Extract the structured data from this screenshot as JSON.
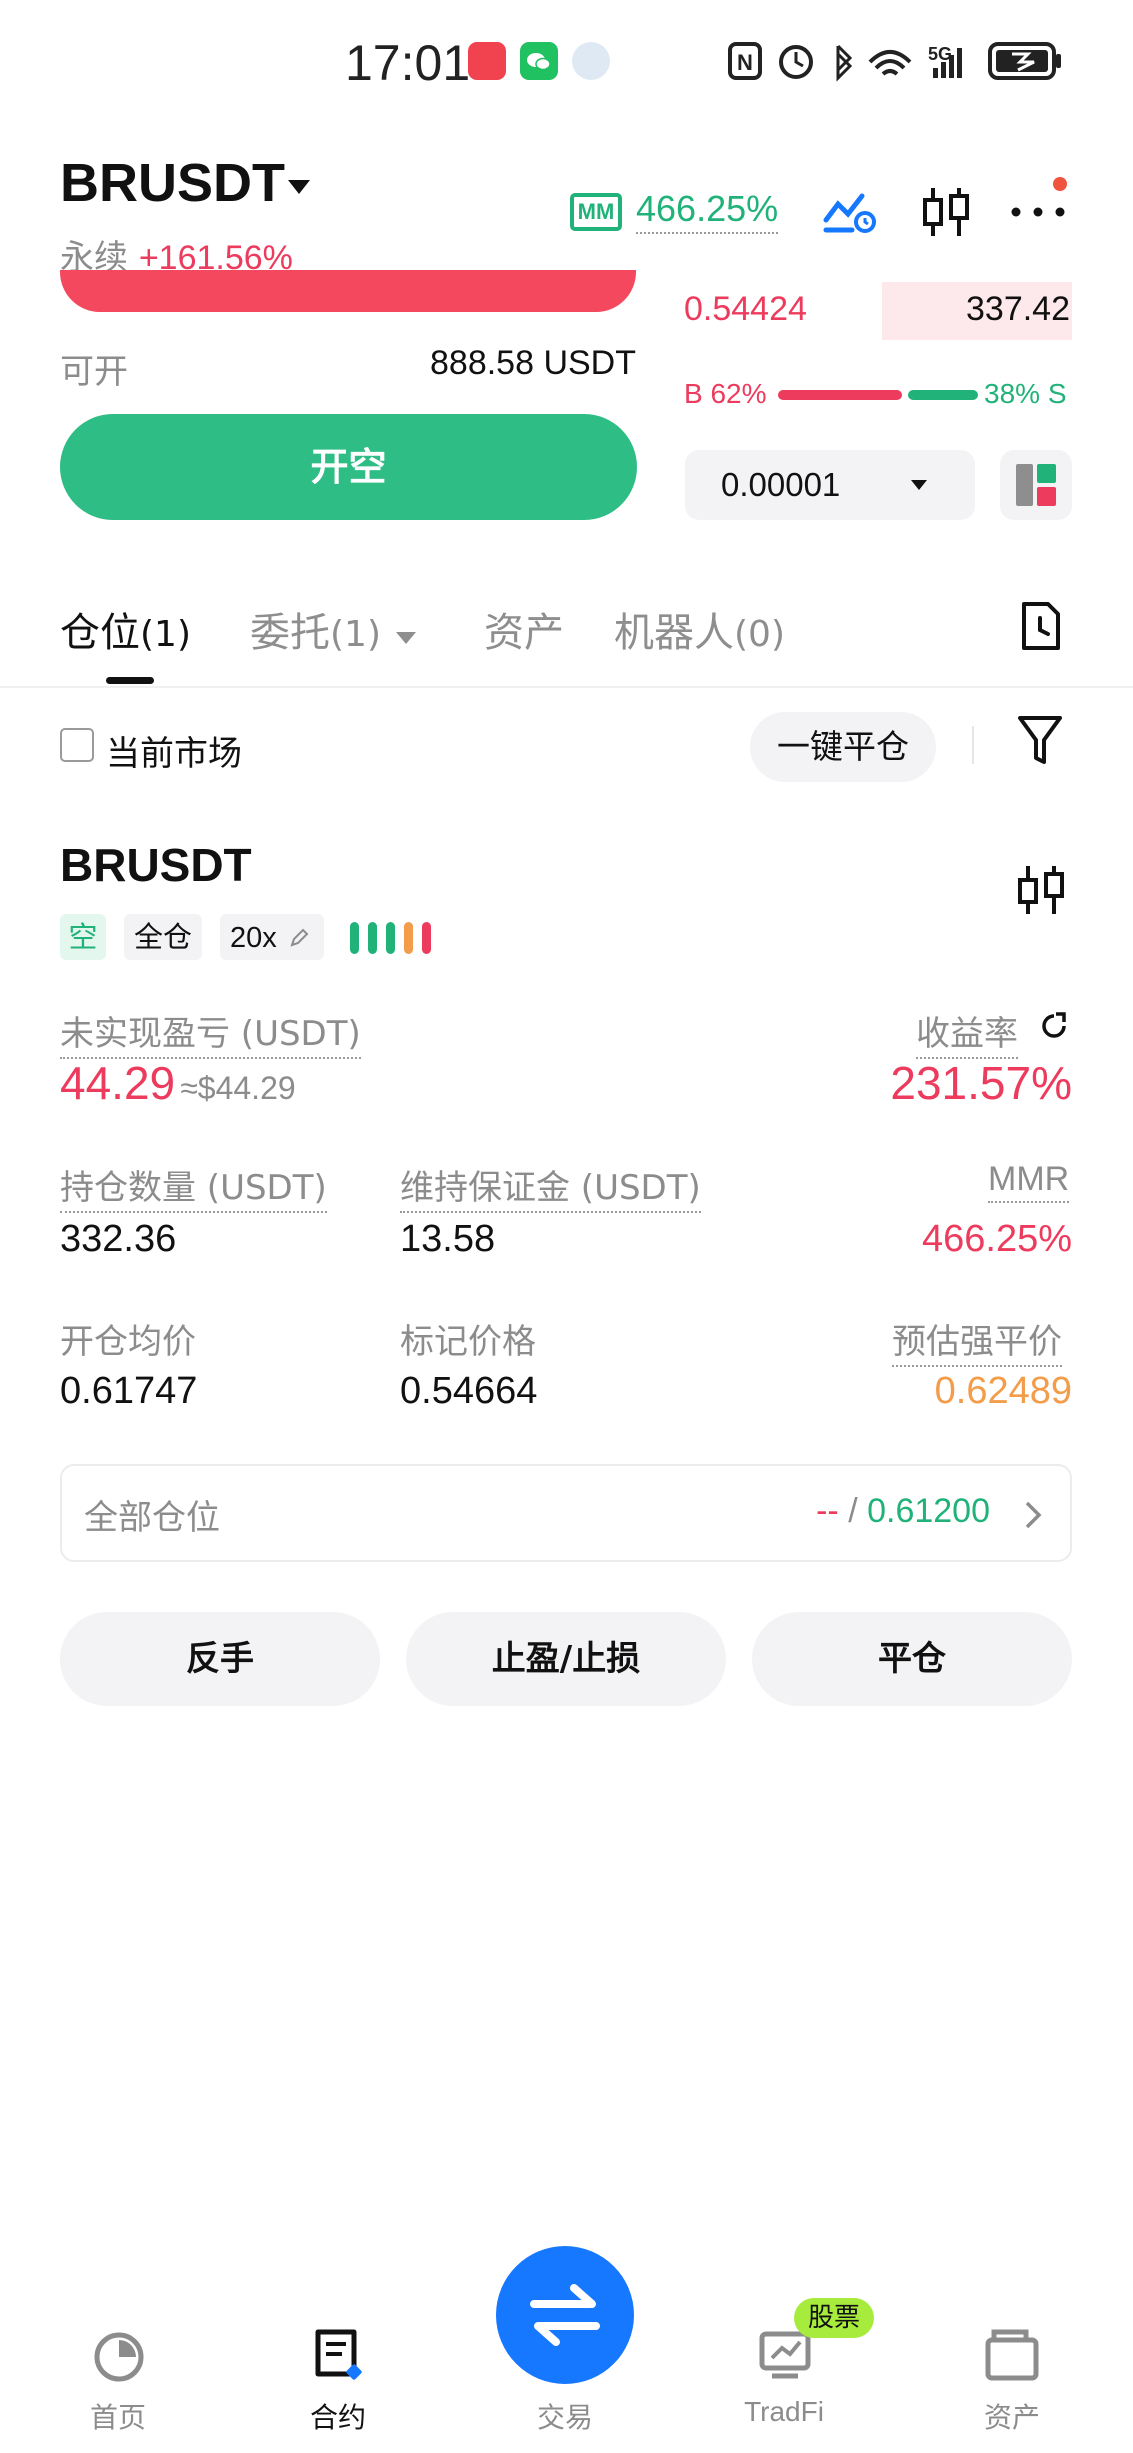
{
  "status_bar": {
    "time": "17:01",
    "network": "5G"
  },
  "header": {
    "symbol": "BRUSDT",
    "contract_type": "永续",
    "change_pct": "+161.56%",
    "mmr_badge": "MM",
    "mmr_value": "466.25%"
  },
  "order_form": {
    "available_label": "可开",
    "available_value": "888.58 USDT",
    "open_short_button": "开空"
  },
  "order_book": {
    "ask_price": "0.54424",
    "ask_size": "337.42",
    "buy_label": "B 62%",
    "sell_label": "38% S",
    "buy_ratio": 0.62,
    "precision": "0.00001"
  },
  "tabs": [
    {
      "label": "仓位",
      "count": "(1)"
    },
    {
      "label": "委托",
      "count": "(1)"
    },
    {
      "label": "资产",
      "count": ""
    },
    {
      "label": "机器人",
      "count": "(0)"
    }
  ],
  "filters": {
    "current_market": "当前市场",
    "close_all": "一键平仓"
  },
  "position": {
    "symbol": "BRUSDT",
    "side_tag": "空",
    "margin_tag": "全仓",
    "leverage_tag": "20x",
    "unrealized_label": "未实现盈亏 (USDT)",
    "unrealized_value": "44.29",
    "unrealized_usd": "≈$44.29",
    "roe_label": "收益率",
    "roe_value": "231.57%",
    "size_label": "持仓数量 (USDT)",
    "size_value": "332.36",
    "maint_margin_label": "维持保证金 (USDT)",
    "maint_margin_value": "13.58",
    "mmr_label": "MMR",
    "mmr_value": "466.25%",
    "entry_label": "开仓均价",
    "entry_value": "0.61747",
    "mark_label": "标记价格",
    "mark_value": "0.54664",
    "liq_label": "预估强平价",
    "liq_value": "0.62489",
    "all_positions_label": "全部仓位",
    "all_positions_tp": "--",
    "all_positions_sep": "/",
    "all_positions_sl": "0.61200",
    "actions": [
      "反手",
      "止盈/止损",
      "平仓"
    ]
  },
  "bottom_nav": [
    {
      "label": "首页"
    },
    {
      "label": "合约"
    },
    {
      "label": "交易"
    },
    {
      "label": "TradFi",
      "badge": "股票"
    },
    {
      "label": "资产"
    }
  ],
  "colors": {
    "green": "#21b27a",
    "red": "#ec3b5d",
    "orange": "#f39c4a",
    "blue": "#1677ff"
  }
}
